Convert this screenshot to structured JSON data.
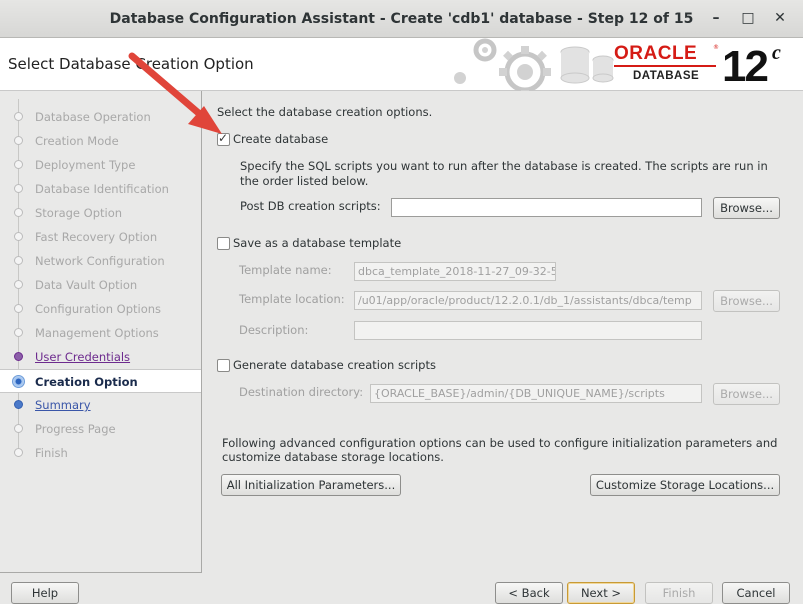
{
  "window": {
    "title": "Database Configuration Assistant - Create 'cdb1' database - Step 12 of 15",
    "minimize": "–",
    "maximize": "□",
    "close": "✕"
  },
  "header": {
    "page_title": "Select Database Creation Option",
    "logo_oracle": "ORACLE",
    "logo_reg": "®",
    "logo_database": "DATABASE",
    "logo_version": "12",
    "logo_version_suffix": "c"
  },
  "sidebar": {
    "steps": [
      {
        "label": "Database Operation",
        "state": "pending"
      },
      {
        "label": "Creation Mode",
        "state": "pending"
      },
      {
        "label": "Deployment Type",
        "state": "pending"
      },
      {
        "label": "Database Identification",
        "state": "pending"
      },
      {
        "label": "Storage Option",
        "state": "pending"
      },
      {
        "label": "Fast Recovery Option",
        "state": "pending"
      },
      {
        "label": "Network Configuration",
        "state": "pending"
      },
      {
        "label": "Data Vault Option",
        "state": "pending"
      },
      {
        "label": "Configuration Options",
        "state": "pending"
      },
      {
        "label": "Management Options",
        "state": "pending"
      },
      {
        "label": "User Credentials",
        "state": "done"
      },
      {
        "label": "Creation Option",
        "state": "current"
      },
      {
        "label": "Summary",
        "state": "next"
      },
      {
        "label": "Progress Page",
        "state": "pending"
      },
      {
        "label": "Finish",
        "state": "pending"
      }
    ]
  },
  "main": {
    "intro": "Select the database creation options.",
    "create_db": {
      "label": "Create database",
      "checked": true,
      "desc_line1": "Specify the SQL scripts you want to run after the database is created. The scripts are run in",
      "desc_line2": "the order listed below.",
      "post_label": "Post DB creation scripts:",
      "post_value": "",
      "browse": "Browse..."
    },
    "template": {
      "label": "Save as a database template",
      "checked": false,
      "name_label": "Template name:",
      "name_value": "dbca_template_2018-11-27_09-32-5",
      "location_label": "Template location:",
      "location_value": "/u01/app/oracle/product/12.2.0.1/db_1/assistants/dbca/temp",
      "browse": "Browse...",
      "description_label": "Description:",
      "description_value": ""
    },
    "scripts": {
      "label": "Generate database creation scripts",
      "checked": false,
      "dest_label": "Destination directory:",
      "dest_value": "{ORACLE_BASE}/admin/{DB_UNIQUE_NAME}/scripts",
      "browse": "Browse..."
    },
    "advanced_line1": "Following advanced configuration options can be used to configure initialization parameters and",
    "advanced_line2": "customize database storage locations.",
    "init_params_button": "All Initialization Parameters...",
    "storage_button": "Customize Storage Locations..."
  },
  "footer": {
    "help": "Help",
    "back": "< Back",
    "next": "Next >",
    "finish": "Finish",
    "cancel": "Cancel"
  },
  "colors": {
    "oracle_red": "#d51b15",
    "annotation_arrow": "#e0453a",
    "step_current": "#2d65bf"
  }
}
